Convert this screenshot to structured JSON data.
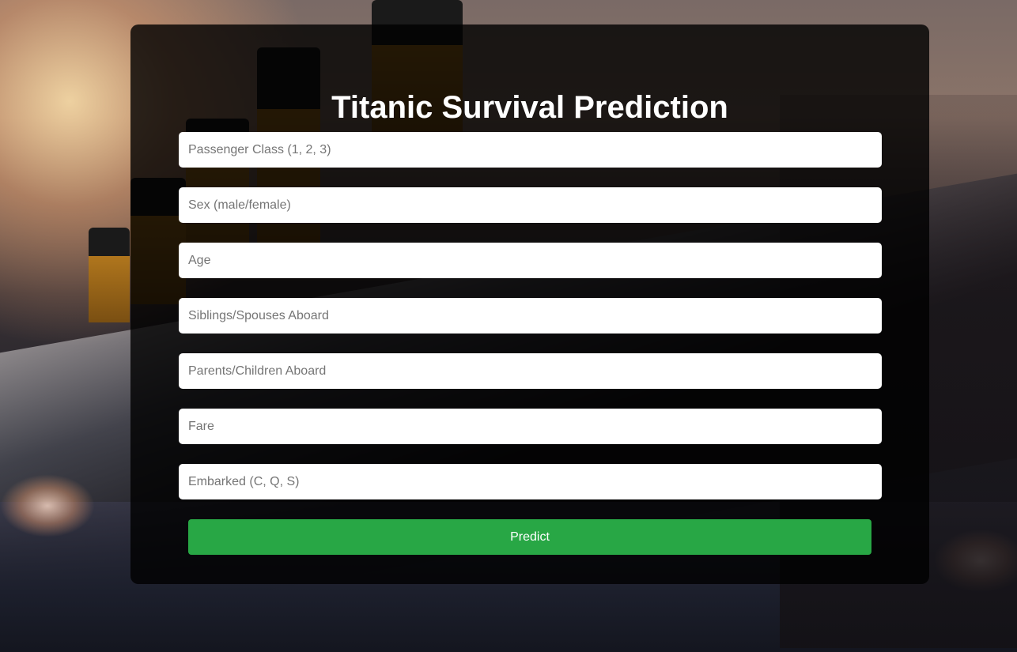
{
  "page": {
    "title": "Titanic Survival Prediction"
  },
  "form": {
    "fields": [
      {
        "placeholder": "Passenger Class (1, 2, 3)",
        "value": ""
      },
      {
        "placeholder": "Sex (male/female)",
        "value": ""
      },
      {
        "placeholder": "Age",
        "value": ""
      },
      {
        "placeholder": "Siblings/Spouses Aboard",
        "value": ""
      },
      {
        "placeholder": "Parents/Children Aboard",
        "value": ""
      },
      {
        "placeholder": "Fare",
        "value": ""
      },
      {
        "placeholder": "Embarked (C, Q, S)",
        "value": ""
      }
    ],
    "submit_label": "Predict"
  },
  "colors": {
    "panel_background": "#000000cc",
    "button": "#28a745",
    "title_text": "#ffffff"
  }
}
